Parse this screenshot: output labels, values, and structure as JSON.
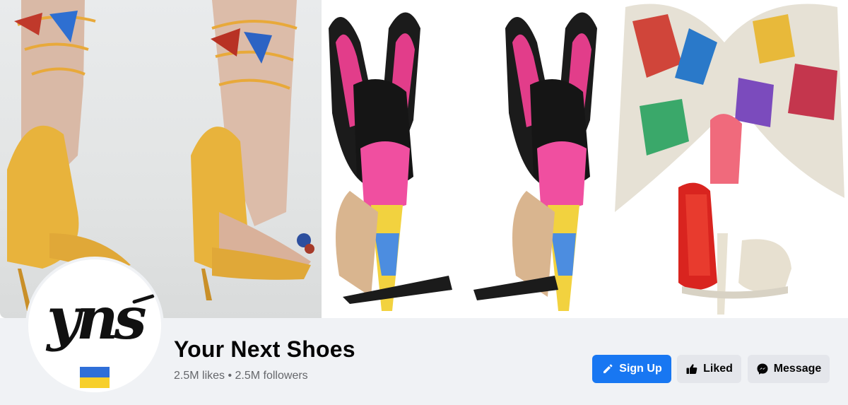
{
  "cover": {
    "panels": [
      {
        "subject": "yellow suede lace-up heels with butterflies"
      },
      {
        "subject": "butterfly embroidered heels back view"
      },
      {
        "subject": "graphic print bow sandal with red sole"
      }
    ]
  },
  "profile": {
    "logo_text": "yns",
    "flag": "ukraine-flag-icon",
    "name": "Your Next Shoes",
    "stats": "2.5M likes • 2.5M followers"
  },
  "actions": {
    "signup_label": "Sign Up",
    "liked_label": "Liked",
    "message_label": "Message"
  },
  "colors": {
    "primary": "#1877f2",
    "secondary_button": "#e4e6eb",
    "page_bg": "#f0f2f5",
    "text_primary": "#050505",
    "text_secondary": "#65676b"
  }
}
